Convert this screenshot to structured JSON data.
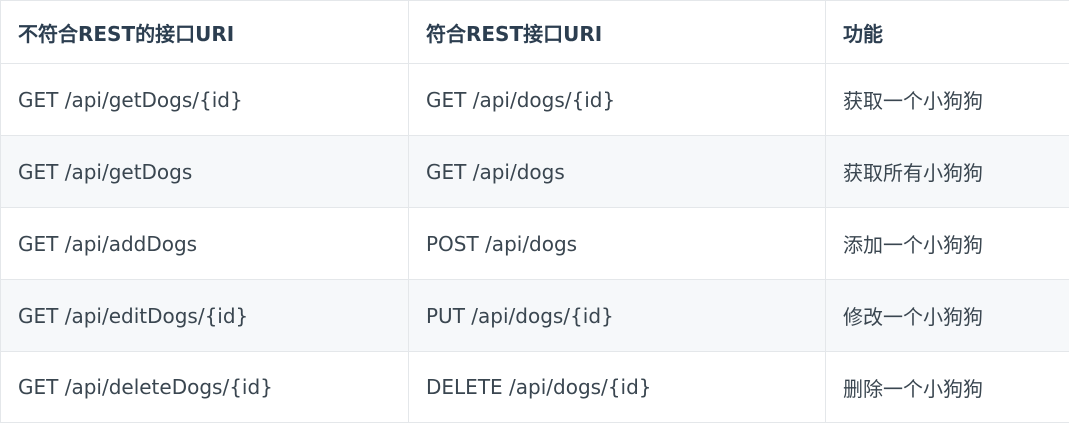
{
  "headers": [
    "不符合REST的接口URI",
    "符合REST接口URI",
    "功能"
  ],
  "rows": [
    [
      "GET /api/getDogs/{id}",
      "GET /api/dogs/{id}",
      "获取一个小狗狗"
    ],
    [
      "GET /api/getDogs",
      "GET /api/dogs",
      "获取所有小狗狗"
    ],
    [
      "GET /api/addDogs",
      "POST /api/dogs",
      "添加一个小狗狗"
    ],
    [
      "GET /api/editDogs/{id}",
      "PUT /api/dogs/{id}",
      "修改一个小狗狗"
    ],
    [
      "GET /api/deleteDogs/{id}",
      "DELETE /api/dogs/{id}",
      "删除一个小狗狗"
    ]
  ]
}
